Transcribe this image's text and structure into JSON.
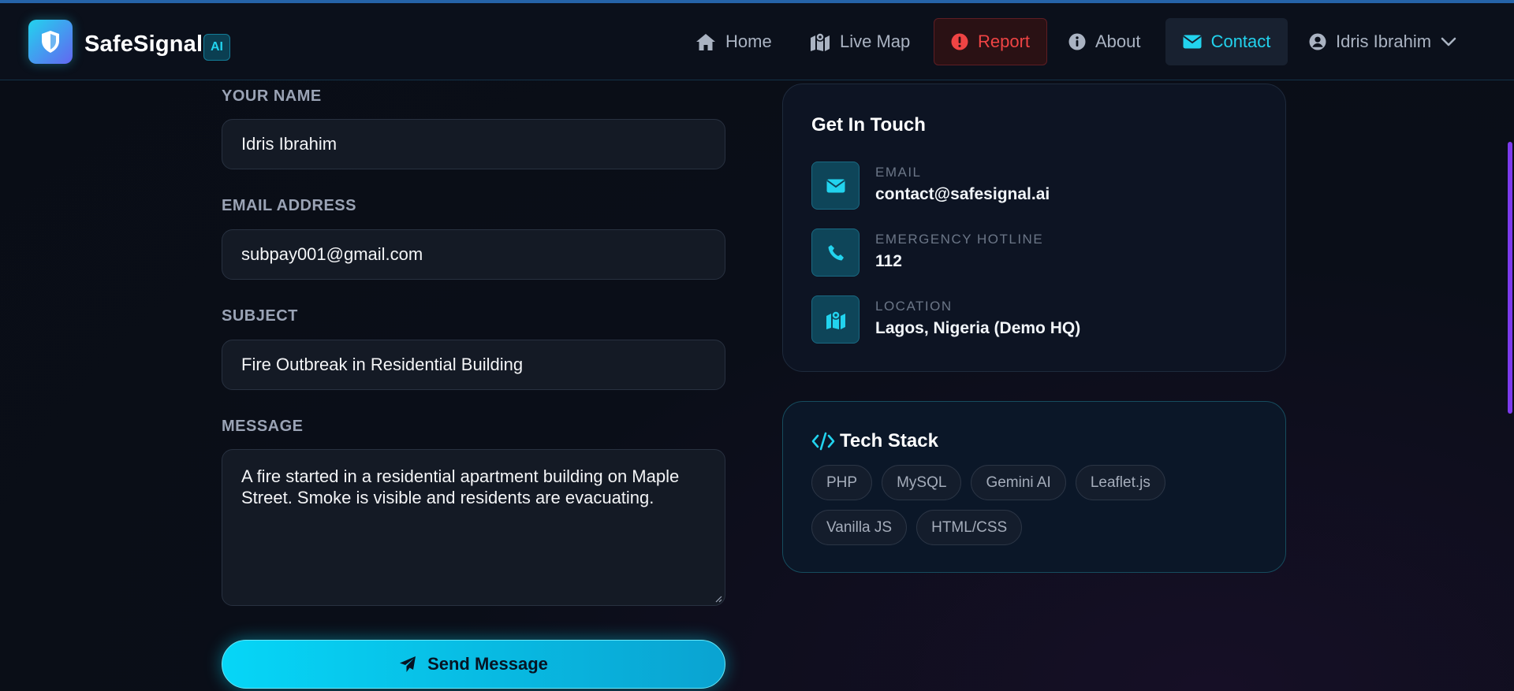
{
  "header": {
    "brand": "SafeSignal",
    "badge": "AI",
    "nav": {
      "home": "Home",
      "live_map": "Live Map",
      "report": "Report",
      "about": "About",
      "contact": "Contact"
    },
    "user_name": "Idris Ibrahim"
  },
  "form": {
    "name_label": "YOUR NAME",
    "name_value": "Idris Ibrahim",
    "email_label": "EMAIL ADDRESS",
    "email_value": "subpay001@gmail.com",
    "subject_label": "SUBJECT",
    "subject_value": "Fire Outbreak in Residential Building",
    "message_label": "MESSAGE",
    "message_value": "A fire started in a residential apartment building on Maple Street. Smoke is visible and residents are evacuating.",
    "submit_label": "Send Message"
  },
  "contact_card": {
    "title": "Get In Touch",
    "items": [
      {
        "icon": "envelope-icon",
        "label": "EMAIL",
        "value": "contact@safesignal.ai"
      },
      {
        "icon": "phone-icon",
        "label": "EMERGENCY HOTLINE",
        "value": "112"
      },
      {
        "icon": "map-icon",
        "label": "LOCATION",
        "value": "Lagos, Nigeria (Demo HQ)"
      }
    ]
  },
  "tech_card": {
    "title": "Tech Stack",
    "tags": [
      "PHP",
      "MySQL",
      "Gemini AI",
      "Leaflet.js",
      "Vanilla JS",
      "HTML/CSS"
    ]
  },
  "colors": {
    "accent": "#22d3ee",
    "report": "#ef4444",
    "background": "#090d16",
    "scrollbar": "#7c3aed"
  }
}
